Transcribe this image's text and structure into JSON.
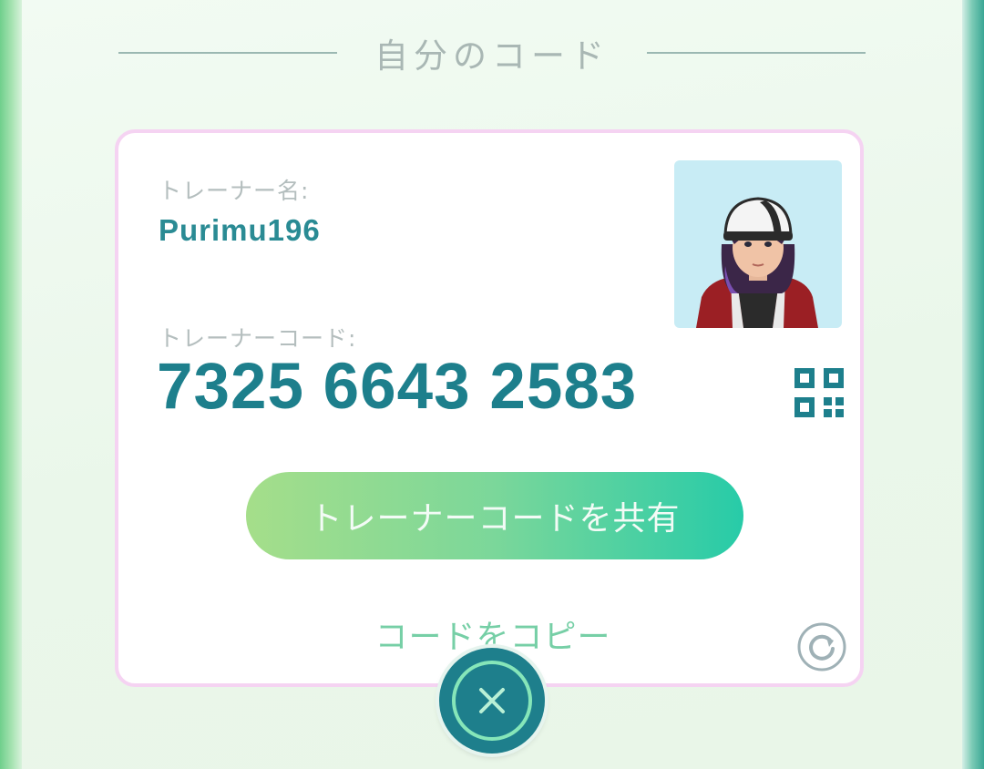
{
  "header": {
    "title": "自分のコード"
  },
  "trainer": {
    "name_label": "トレーナー名:",
    "name": "Purimu196",
    "code_label": "トレーナーコード:",
    "code": "7325 6643 2583"
  },
  "actions": {
    "share_label": "トレーナーコードを共有",
    "copy_label": "コードをコピー"
  },
  "icons": {
    "qr": "qr-code-icon",
    "refresh": "refresh-icon",
    "close": "close-icon",
    "avatar": "trainer-avatar"
  },
  "colors": {
    "accent_teal": "#1d7f8c",
    "card_border": "#f5d3f2",
    "button_gradient_start": "#a5de8a",
    "button_gradient_end": "#27cba8",
    "copy_text": "#76cfa6"
  }
}
